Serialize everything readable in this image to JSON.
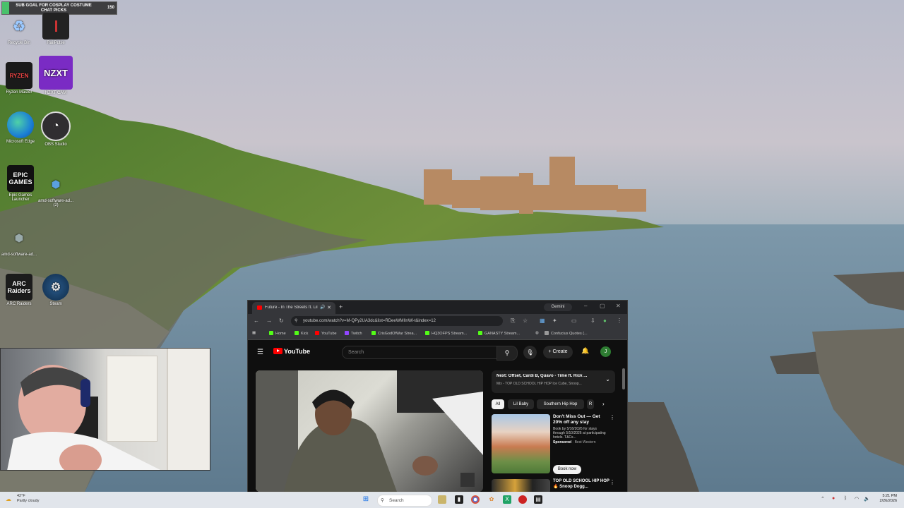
{
  "overlay": {
    "subgoal_text": "SUB GOAL FOR COSPLAY COSTUME CHAT PICKS",
    "subgoal_count": "150"
  },
  "desktop_icons": [
    {
      "label": "Recycle Bin",
      "icon": "recycle-bin-icon"
    },
    {
      "label": "RailPulse",
      "icon": "app-icon"
    },
    {
      "label": "Ryzen Master",
      "icon": "ryzen-icon"
    },
    {
      "label": "NZXT CAM",
      "icon": "nzxt-icon",
      "text": "NZXT"
    },
    {
      "label": "Microsoft Edge",
      "icon": "edge-icon"
    },
    {
      "label": "OBS Studio",
      "icon": "obs-icon"
    },
    {
      "label": "Epic Games Launcher",
      "icon": "epic-icon",
      "text": "EPIC GAMES"
    },
    {
      "label": "amd-software-ad... (2)",
      "icon": "installer-icon"
    },
    {
      "label": "amd-software-ad...",
      "icon": "installer-icon"
    },
    {
      "label": "ARC Raiders",
      "icon": "arc-raiders-icon",
      "text": "ARC Raiders"
    },
    {
      "label": "Steam",
      "icon": "steam-icon"
    }
  ],
  "browser": {
    "tab_title": "Future - In The Streets ft. Lil",
    "gemini_label": "Gemini",
    "url": "youtube.com/watch?v=M-QPy2UA3dc&list=RDeeWMIlnWl-t&index=12",
    "bookmarks": [
      "Home",
      "Kick",
      "YouTube",
      "Twitch",
      "CrisGodOfWar Strea...",
      "HQ3OFPS Stream...",
      "GANASTY Stream...",
      "Confucius Quotes (..."
    ],
    "youtube": {
      "logo_text": "YouTube",
      "search_placeholder": "Search",
      "create_label": "Create",
      "avatar_letter": "J",
      "next_title": "Next: Offset, Cardi B, Quavo - Time ft. Rick ...",
      "next_sub": "Mix - TOP OLD SCHOOL HIP HOP Ice Cube, Snoop...",
      "chips": [
        "All",
        "Lil Baby",
        "Southern Hip Hop",
        "R"
      ],
      "ad_title": "Don't Miss Out — Get 20% off any stay",
      "ad_body": "Book by 5/16/2026 for stays through 5/10/2026 at participating hotels. T&Cs...",
      "ad_sponsor_label": "Sponsored",
      "ad_sponsor": "Best Western",
      "ad_button": "Book now",
      "rec2_title": "TOP OLD SCHOOL HIP HOP 🔥 Snoop Dogg..."
    }
  },
  "taskbar": {
    "weather_temp": "42°F",
    "weather_desc": "Partly cloudy",
    "search_placeholder": "Search",
    "time": "5:21 PM",
    "date": "2/26/2026"
  },
  "colors": {
    "youtube_red": "#ff0000",
    "yt_bg": "#0f0f0f",
    "browser_bg": "#202124",
    "taskbar": "#eceef2"
  }
}
